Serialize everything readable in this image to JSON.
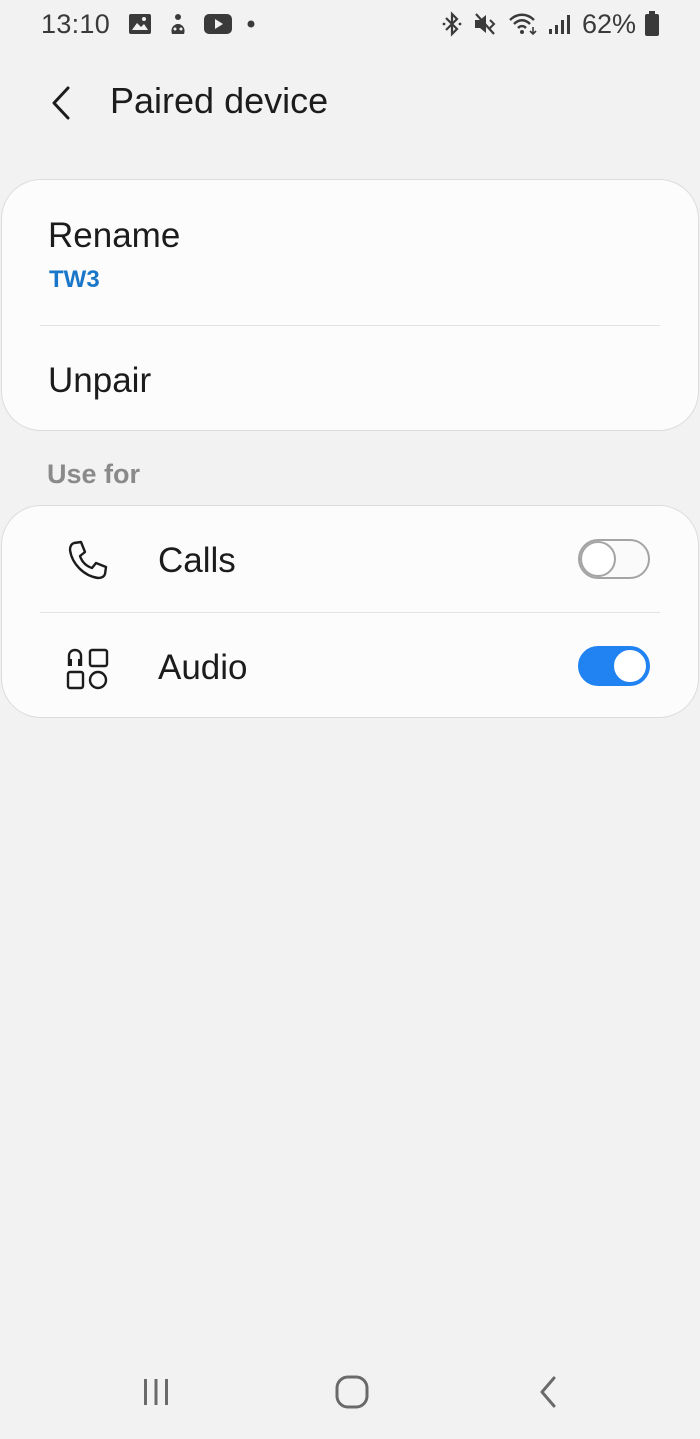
{
  "status_bar": {
    "time": "13:10",
    "battery_percent": "62%",
    "left_icons": [
      "gallery-icon",
      "game-icon",
      "youtube-icon",
      "notification-dot-icon"
    ],
    "right_icons": [
      "bluetooth-icon",
      "mute-icon",
      "wifi-icon",
      "signal-icon",
      "battery-icon"
    ]
  },
  "header": {
    "title": "Paired device"
  },
  "device_card": {
    "rename_label": "Rename",
    "device_name": "TW3",
    "unpair_label": "Unpair"
  },
  "use_for": {
    "section_label": "Use for",
    "options": [
      {
        "label": "Calls",
        "icon": "phone-icon",
        "enabled": false
      },
      {
        "label": "Audio",
        "icon": "audio-apps-icon",
        "enabled": true
      }
    ]
  },
  "colors": {
    "accent": "#2183f2",
    "link": "#1976c8",
    "background": "#f2f2f2",
    "card": "#fcfcfc"
  },
  "nav_bar": {
    "icons": [
      "recent-apps-icon",
      "home-icon",
      "back-icon"
    ]
  }
}
